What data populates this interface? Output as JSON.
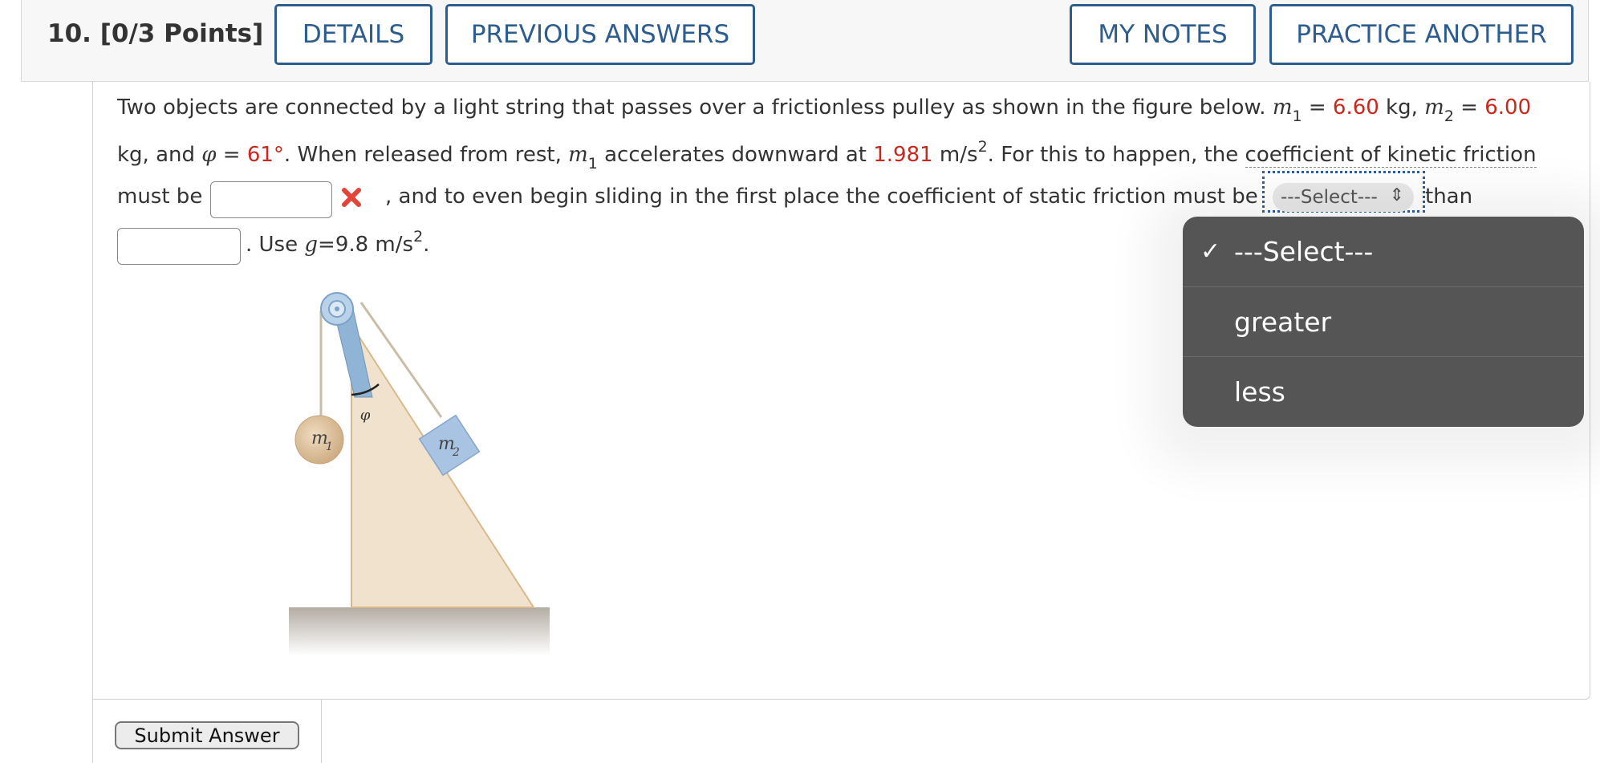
{
  "header": {
    "question_number": "10.",
    "points": "[0/3 Points]",
    "details_label": "DETAILS",
    "previous_answers_label": "PREVIOUS ANSWERS",
    "my_notes_label": "MY NOTES",
    "practice_another_label": "PRACTICE ANOTHER"
  },
  "problem": {
    "line1_text": "Two objects are connected by a light string that passes over a frictionless pulley as shown in the figure below. ",
    "m1_symbol": "m",
    "m1_sub": "1",
    "equals": " = ",
    "m1_value": "6.60",
    "m1_unit": " kg, ",
    "m2_symbol": "m",
    "m2_sub": "2",
    "m2_value": "6.00",
    "line2_start": "kg, and ",
    "phi_symbol": "φ",
    "phi_value": "61°",
    "line2_mid": ". When released from rest, ",
    "line2_accel": " accelerates downward at ",
    "accel_value": "1.981",
    "accel_unit": " m/s",
    "sup2": "2",
    "line2_end": ". For this to happen, the ",
    "coef_kinetic": "coefficient of kinetic friction",
    "line3_start": "must be",
    "line3_mid": ", and to even begin sliding in the first place the coefficient of static friction must be",
    "line3_end": "than",
    "line4_text": ". Use ",
    "g_symbol": "g",
    "g_text": "=9.8 m/s",
    "line4_end": "."
  },
  "kinetic_input_value": "",
  "static_input_value": "",
  "feedback_icon": "x-mark-icon",
  "select": {
    "current": "---Select---",
    "options": [
      {
        "label": "---Select---",
        "selected": true
      },
      {
        "label": "greater",
        "selected": false
      },
      {
        "label": "less",
        "selected": false
      }
    ],
    "check_glyph": "✓"
  },
  "figure": {
    "m1_label": "m",
    "m1_sub": "1",
    "m2_label": "m",
    "m2_sub": "2",
    "phi_label": "φ"
  },
  "submit_label": "Submit Answer",
  "colors": {
    "accent": "#2d5d8f",
    "red_value": "#c8281d",
    "dropdown_bg": "#555555"
  }
}
